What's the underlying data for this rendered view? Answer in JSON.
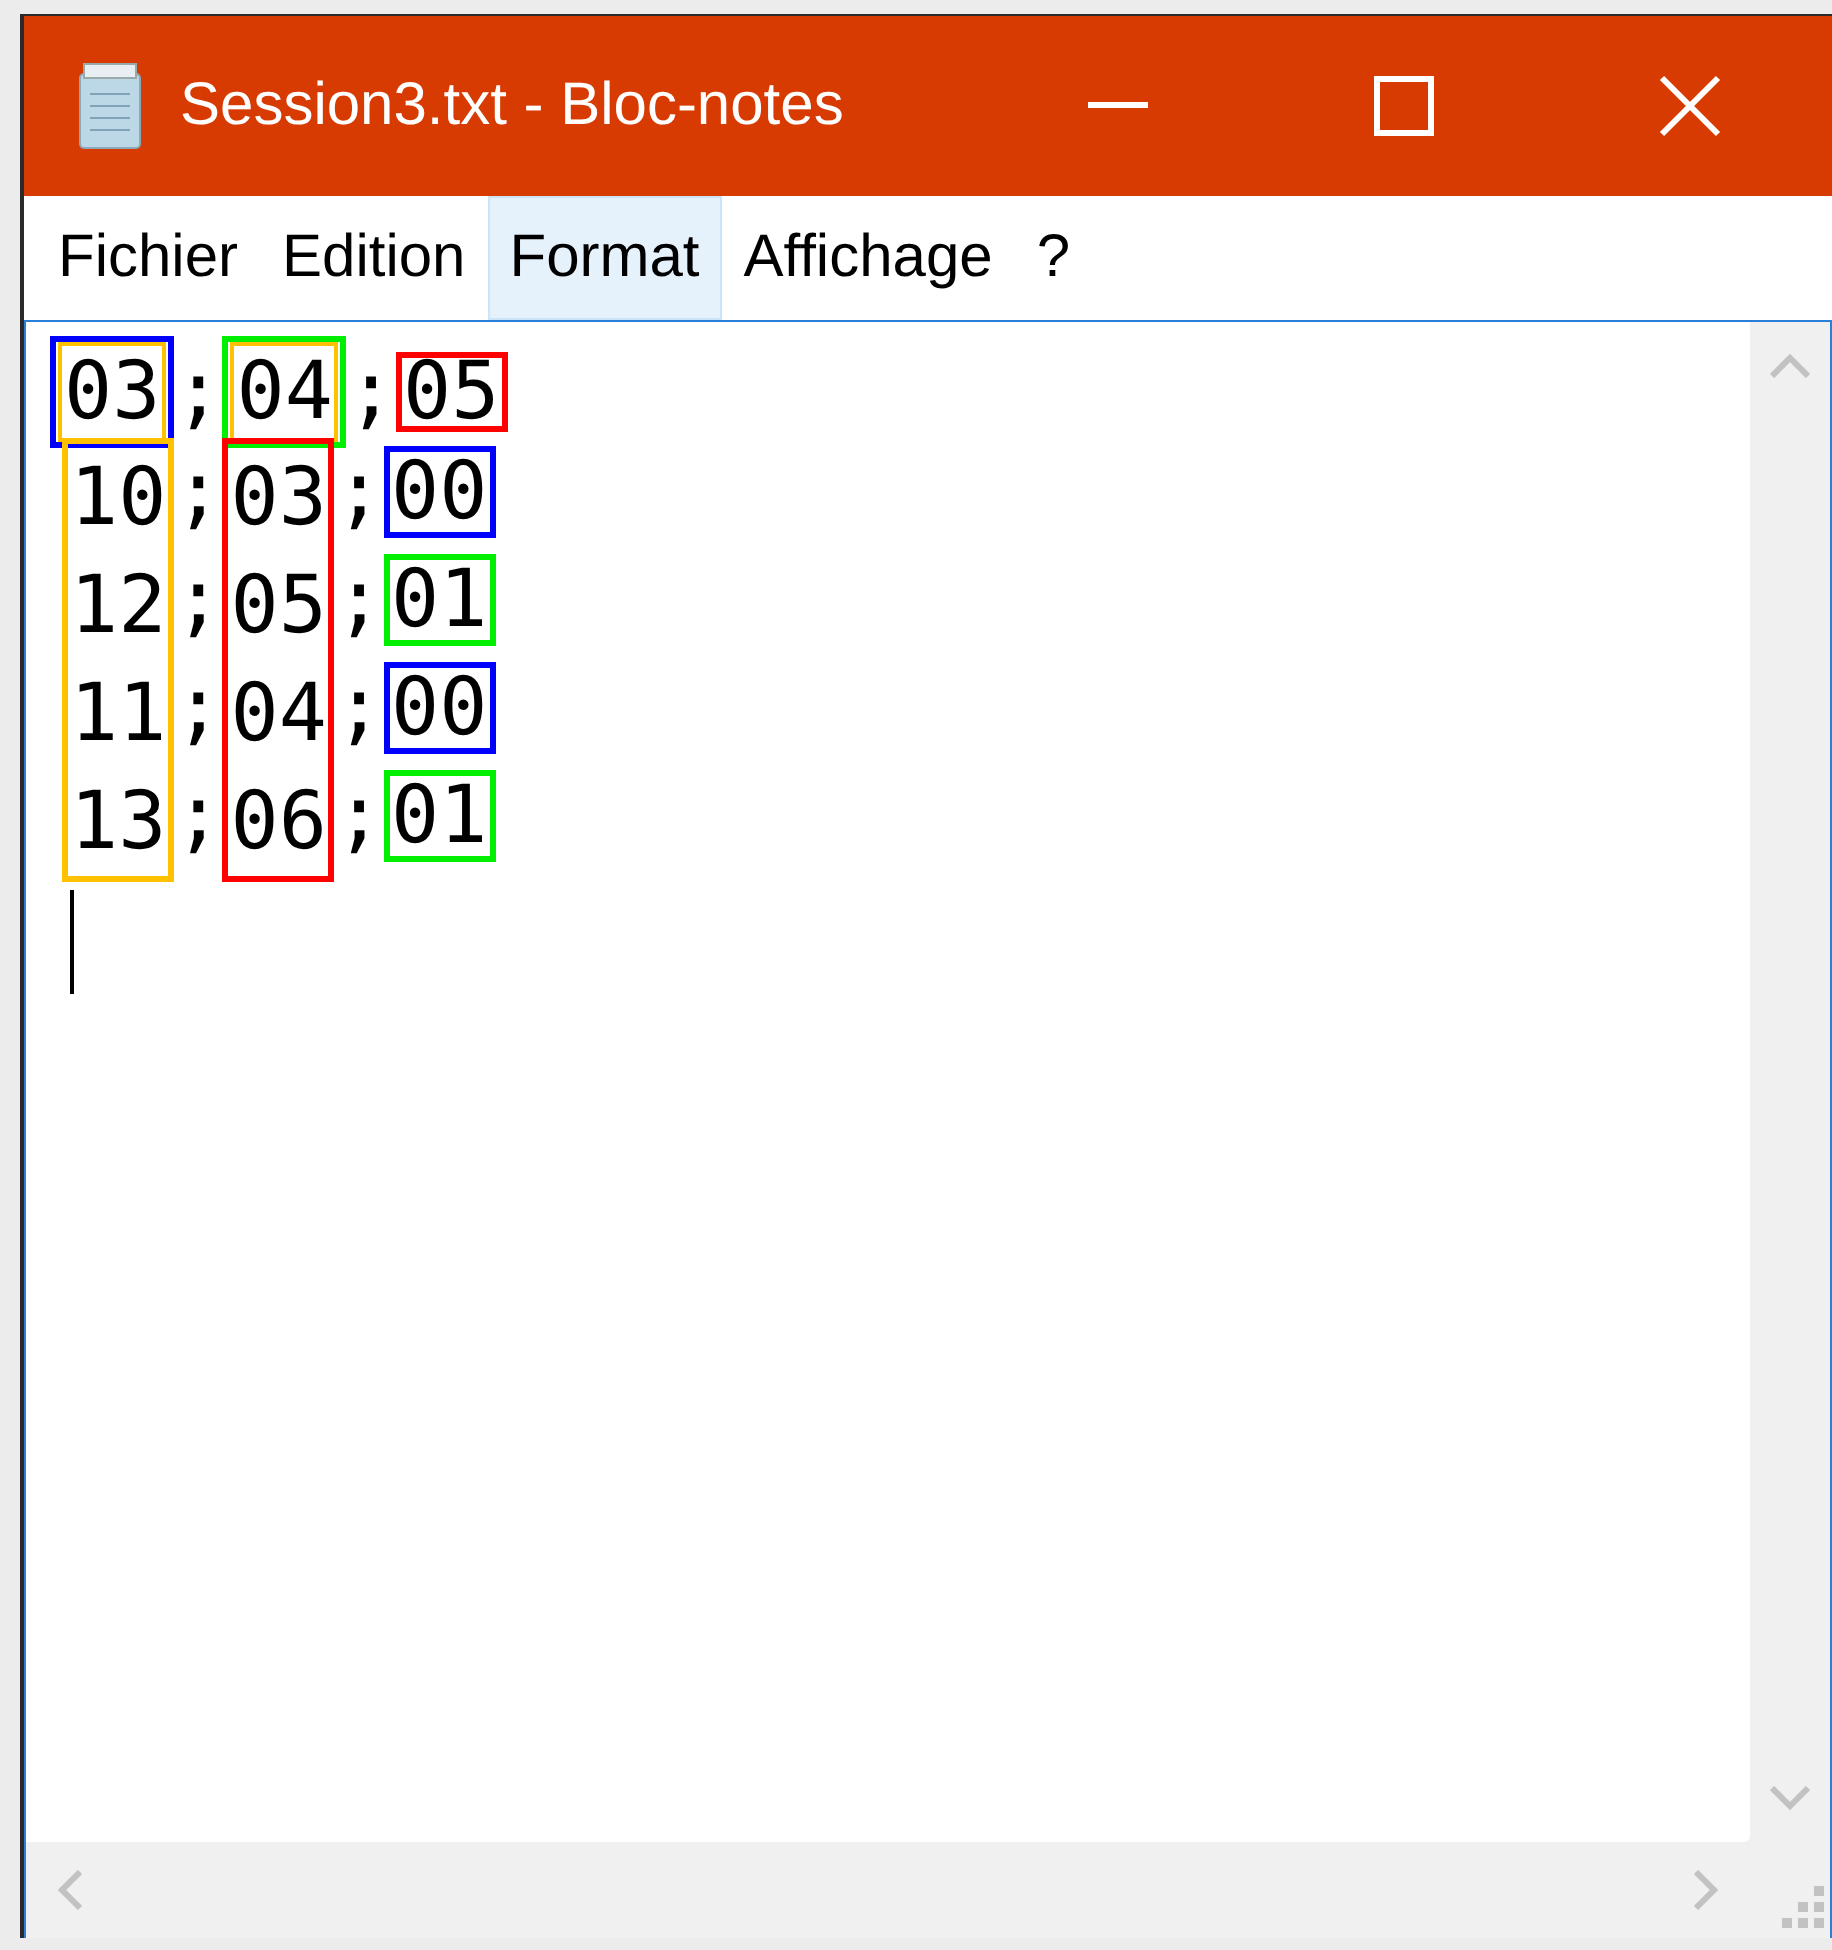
{
  "window": {
    "title": "Session3.txt - Bloc-notes"
  },
  "menu": [
    {
      "label": "Fichier",
      "selected": false
    },
    {
      "label": "Edition",
      "selected": false
    },
    {
      "label": "Format",
      "selected": true
    },
    {
      "label": "Affichage",
      "selected": false
    },
    {
      "label": "?",
      "selected": false
    }
  ],
  "editor": {
    "first_line": [
      {
        "text": "03",
        "color": "#0000ff",
        "inner_frame": {
          "color": "#ffc000"
        }
      },
      {
        "text": ";"
      },
      {
        "text": "04",
        "color": "#00ee00",
        "inner_frame": {
          "color": "#ffc000"
        }
      },
      {
        "text": ";"
      },
      {
        "text": "05",
        "color": "#ff0000"
      }
    ],
    "columns": [
      {
        "color": "#ffc000",
        "cells": [
          {
            "text": "10"
          },
          {
            "text": "12"
          },
          {
            "text": "11"
          },
          {
            "text": "13"
          }
        ]
      },
      {
        "cells": [
          {
            "text": ";"
          },
          {
            "text": ";"
          },
          {
            "text": ";"
          },
          {
            "text": ";"
          }
        ]
      },
      {
        "color": "#ff0000",
        "cells": [
          {
            "text": "03"
          },
          {
            "text": "05"
          },
          {
            "text": "04"
          },
          {
            "text": "06"
          }
        ]
      },
      {
        "cells": [
          {
            "text": ";"
          },
          {
            "text": ";"
          },
          {
            "text": ";"
          },
          {
            "text": ";"
          }
        ]
      },
      {
        "cells": [
          {
            "text": "00",
            "color": "#0000ff"
          },
          {
            "text": "01",
            "color": "#00ee00"
          },
          {
            "text": "00",
            "color": "#0000ff"
          },
          {
            "text": "01",
            "color": "#00ee00"
          }
        ]
      }
    ]
  }
}
